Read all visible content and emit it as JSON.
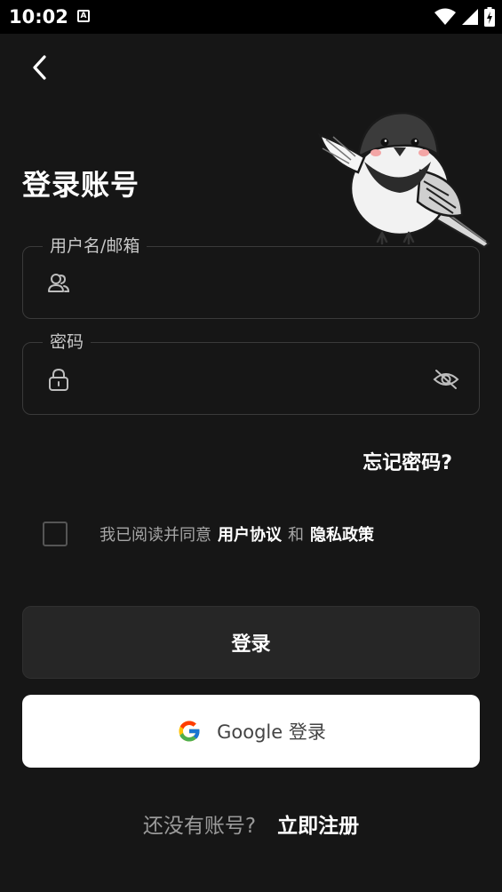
{
  "status_bar": {
    "time": "10:02",
    "notif_icon": "A"
  },
  "header": {
    "title": "登录账号"
  },
  "username_field": {
    "label": "用户名/邮箱",
    "value": "",
    "placeholder": ""
  },
  "password_field": {
    "label": "密码",
    "value": "",
    "placeholder": ""
  },
  "forgot_password": "忘记密码?",
  "agreement": {
    "checked": false,
    "prefix": "我已阅读并同意",
    "user_agreement": "用户协议",
    "and": "和",
    "privacy_policy": "隐私政策"
  },
  "login_button": "登录",
  "google_button": {
    "label": "Google 登录"
  },
  "register": {
    "prompt": "还没有账号?",
    "link": "立即注册"
  },
  "colors": {
    "background": "#161616",
    "field_border": "#3a3a3a",
    "button_dark": "#262626",
    "button_light": "#ffffff",
    "text_muted": "#a6a6a6"
  }
}
